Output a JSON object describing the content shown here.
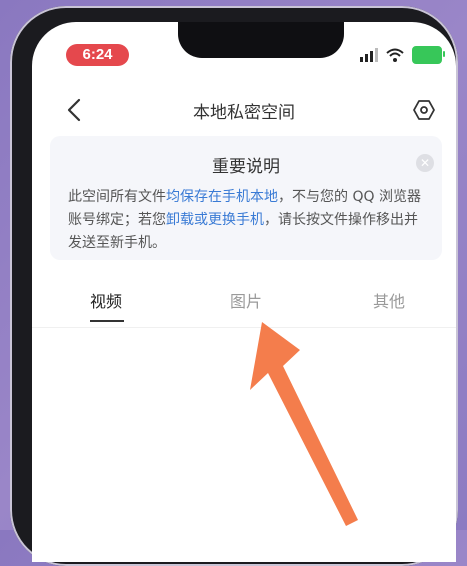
{
  "status_bar": {
    "time": "6:24"
  },
  "nav": {
    "title": "本地私密空间"
  },
  "notice": {
    "title": "重要说明",
    "body_parts": [
      {
        "text": "此空间所有文件",
        "highlight": false
      },
      {
        "text": "均保存在手机本地",
        "highlight": true
      },
      {
        "text": "，不与您的 QQ 浏览器账号绑定；若您",
        "highlight": false
      },
      {
        "text": "卸载或更换手机",
        "highlight": true
      },
      {
        "text": "，请长按文件操作移出并发送至新手机。",
        "highlight": false
      }
    ]
  },
  "tabs": [
    {
      "label": "视频",
      "active": true
    },
    {
      "label": "图片",
      "active": false
    },
    {
      "label": "其他",
      "active": false
    }
  ],
  "colors": {
    "background": "#8f7dc4",
    "time_pill": "#e5484d",
    "highlight": "#3a7bd5",
    "battery": "#37c759",
    "arrow": "#f47d4c"
  }
}
